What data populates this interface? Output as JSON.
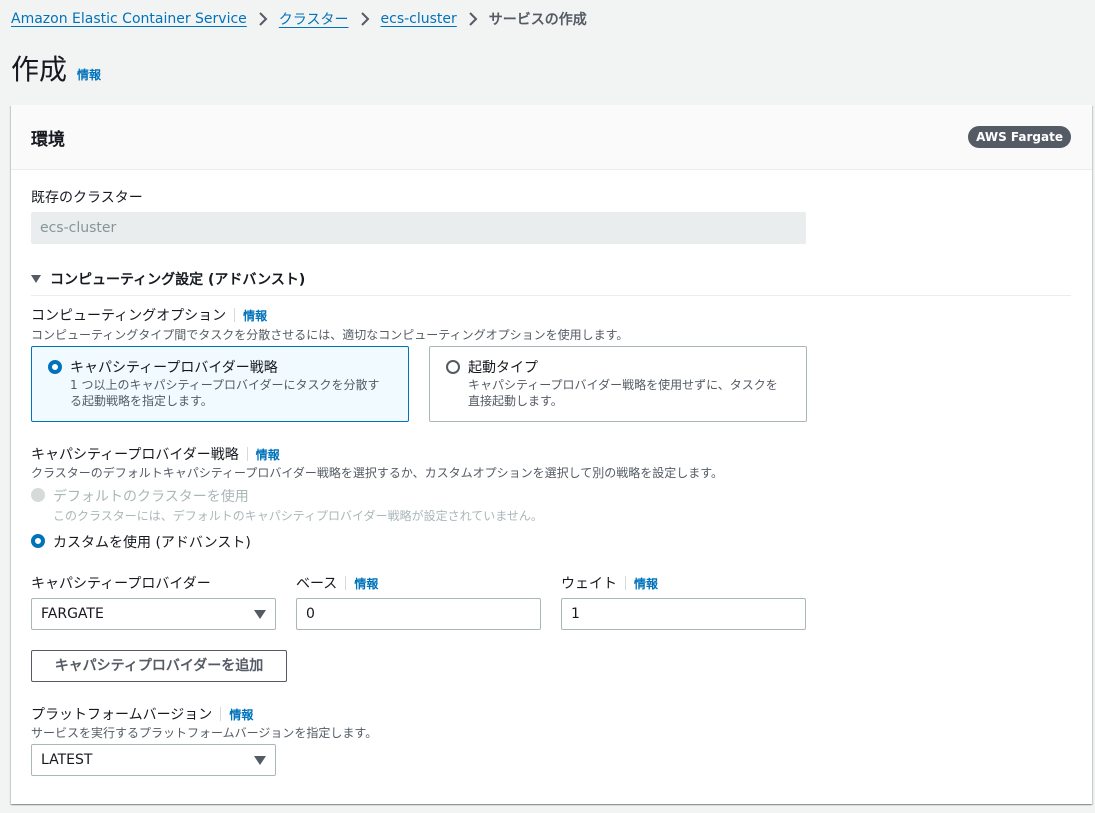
{
  "breadcrumb": {
    "items": [
      "Amazon Elastic Container Service",
      "クラスター",
      "ecs-cluster"
    ],
    "current": "サービスの作成"
  },
  "page": {
    "title": "作成",
    "info": "情報"
  },
  "panel": {
    "title": "環境",
    "badge": "AWS Fargate",
    "existing_cluster": {
      "label": "既存のクラスター",
      "value": "ecs-cluster"
    },
    "compute": {
      "expander_label": "コンピューティング設定 (アドバンスト)",
      "option_label": "コンピューティングオプション",
      "info": "情報",
      "option_desc": "コンピューティングタイプ間でタスクを分散させるには、適切なコンピューティングオプションを使用します。",
      "tiles": [
        {
          "title": "キャパシティープロバイダー戦略",
          "desc": "1 つ以上のキャパシティープロバイダーにタスクを分散する起動戦略を指定します。",
          "selected": true
        },
        {
          "title": "起動タイプ",
          "desc": "キャパシティープロバイダー戦略を使用せずに、タスクを直接起動します。",
          "selected": false
        }
      ]
    },
    "strategy": {
      "label": "キャパシティープロバイダー戦略",
      "info": "情報",
      "desc": "クラスターのデフォルトキャパシティープロバイダー戦略を選択するか、カスタムオプションを選択して別の戦略を設定します。",
      "default_option": {
        "label": "デフォルトのクラスターを使用",
        "desc": "このクラスターには、デフォルトのキャパシティプロバイダー戦略が設定されていません。"
      },
      "custom_option": {
        "label": "カスタムを使用 (アドバンスト)"
      }
    },
    "provider_row": {
      "provider_label": "キャパシティープロバイダー",
      "provider_value": "FARGATE",
      "base_label": "ベース",
      "base_info": "情報",
      "base_value": "0",
      "weight_label": "ウェイト",
      "weight_info": "情報",
      "weight_value": "1"
    },
    "add_provider_button": "キャパシティプロバイダーを追加",
    "platform": {
      "label": "プラットフォームバージョン",
      "info": "情報",
      "desc": "サービスを実行するプラットフォームバージョンを指定します。",
      "value": "LATEST"
    }
  },
  "colors": {
    "link": "#0073bb",
    "selected_tile_bg": "#f1faff",
    "badge_bg": "#545b64"
  }
}
